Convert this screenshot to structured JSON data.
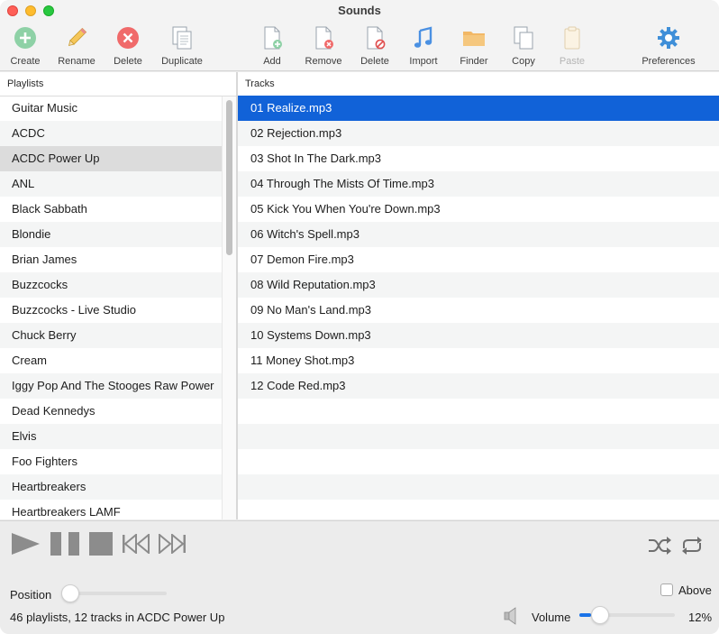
{
  "window": {
    "title": "Sounds"
  },
  "toolbar": {
    "create": "Create",
    "rename": "Rename",
    "delete_playlist": "Delete",
    "duplicate": "Duplicate",
    "add": "Add",
    "remove": "Remove",
    "delete_track": "Delete",
    "import": "Import",
    "finder": "Finder",
    "copy": "Copy",
    "paste": "Paste",
    "preferences": "Preferences"
  },
  "playlists": {
    "header": "Playlists",
    "items": [
      "Guitar Music",
      "ACDC",
      "ACDC Power Up",
      "ANL",
      "Black Sabbath",
      "Blondie",
      "Brian James",
      "Buzzcocks",
      "Buzzcocks - Live Studio",
      "Chuck Berry",
      "Cream",
      "Iggy Pop And The Stooges Raw Power",
      "Dead Kennedys",
      "Elvis",
      "Foo Fighters",
      "Heartbreakers",
      "Heartbreakers LAMF"
    ],
    "selected": "ACDC Power Up"
  },
  "tracks": {
    "header": "Tracks",
    "items": [
      "01 Realize.mp3",
      "02 Rejection.mp3",
      "03 Shot In The Dark.mp3",
      "04 Through The Mists Of Time.mp3",
      "05 Kick You When You're Down.mp3",
      "06 Witch's Spell.mp3",
      "07 Demon Fire.mp3",
      "08 Wild Reputation.mp3",
      "09 No Man's Land.mp3",
      "10 Systems Down.mp3",
      "11 Money Shot.mp3",
      "12 Code Red.mp3"
    ],
    "selected": "01 Realize.mp3"
  },
  "player": {
    "position_label": "Position",
    "position_value": 0.0,
    "above_label": "Above",
    "above_checked": false,
    "volume_label": "Volume",
    "volume_value": 0.12,
    "volume_text": "12%",
    "status": "46 playlists, 12 tracks in ACDC Power Up"
  },
  "colors": {
    "selection_blue": "#1162d8",
    "selection_gray": "#dcdcdc",
    "create_green": "#8ed1a6",
    "delete_red": "#f06a6a",
    "import_blue": "#4a90e2",
    "finder_folder": "#f2b866",
    "prefs_blue": "#3f8fd8"
  }
}
